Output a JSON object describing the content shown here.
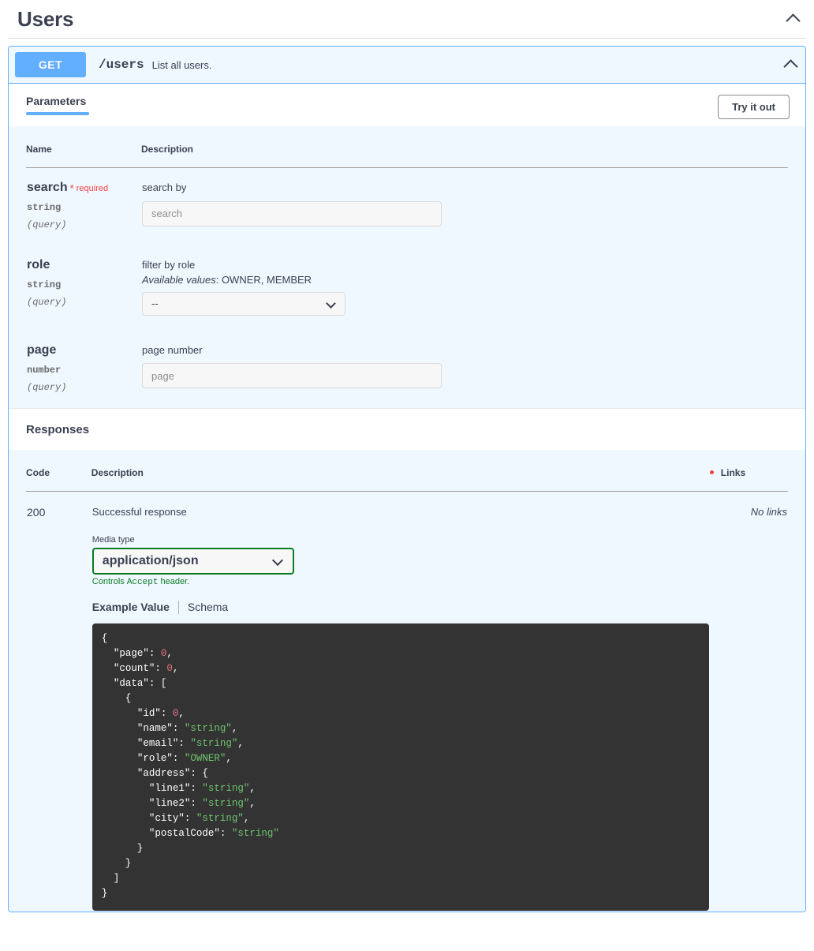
{
  "tag": {
    "title": "Users",
    "collapse_icon": "chevron-up-icon"
  },
  "operation": {
    "method": "GET",
    "path": "/users",
    "summary": "List all users.",
    "collapse_icon": "chevron-up-icon"
  },
  "tabs": {
    "parameters_label": "Parameters",
    "try_it_out_label": "Try it out"
  },
  "parameters_table": {
    "headers": {
      "name": "Name",
      "description": "Description"
    },
    "rows": [
      {
        "name": "search",
        "required_star": "*",
        "required_label": "required",
        "type": "string",
        "in": "(query)",
        "description": "search by",
        "enum_label": "",
        "enum_values": "",
        "control": "input",
        "placeholder": "search",
        "value": ""
      },
      {
        "name": "role",
        "required_star": "",
        "required_label": "",
        "type": "string",
        "in": "(query)",
        "description": "filter by role",
        "enum_label": "Available values",
        "enum_values": ": OWNER, MEMBER",
        "control": "select",
        "selected": "--",
        "options": [
          "--",
          "OWNER",
          "MEMBER"
        ]
      },
      {
        "name": "page",
        "required_star": "",
        "required_label": "",
        "type": "number",
        "in": "(query)",
        "description": "page number",
        "enum_label": "",
        "enum_values": "",
        "control": "input",
        "placeholder": "page",
        "value": ""
      }
    ]
  },
  "responses": {
    "title": "Responses",
    "headers": {
      "code": "Code",
      "description": "Description",
      "links": "Links"
    },
    "rows": [
      {
        "code": "200",
        "description": "Successful response",
        "links": "No links"
      }
    ],
    "media_type": {
      "label": "Media type",
      "selected": "application/json",
      "options": [
        "application/json"
      ],
      "note_prefix": "Controls ",
      "note_code": "Accept",
      "note_suffix": " header."
    },
    "example_tabs": {
      "active": "Example Value",
      "other": "Schema"
    },
    "example_value": "{\n  \"page\": 0,\n  \"count\": 0,\n  \"data\": [\n    {\n      \"id\": 0,\n      \"name\": \"string\",\n      \"email\": \"string\",\n      \"role\": \"OWNER\",\n      \"address\": {\n        \"line1\": \"string\",\n        \"line2\": \"string\",\n        \"city\": \"string\",\n        \"postalCode\": \"string\"\n      }\n    }\n  ]\n}"
  },
  "colors": {
    "method_get": "#61affe",
    "panel_bg": "#eff7ff",
    "required_red": "#f93e3e",
    "media_green": "#0a7d24",
    "code_bg": "#333333",
    "code_string": "#6ec46e",
    "code_number": "#e2777a"
  }
}
